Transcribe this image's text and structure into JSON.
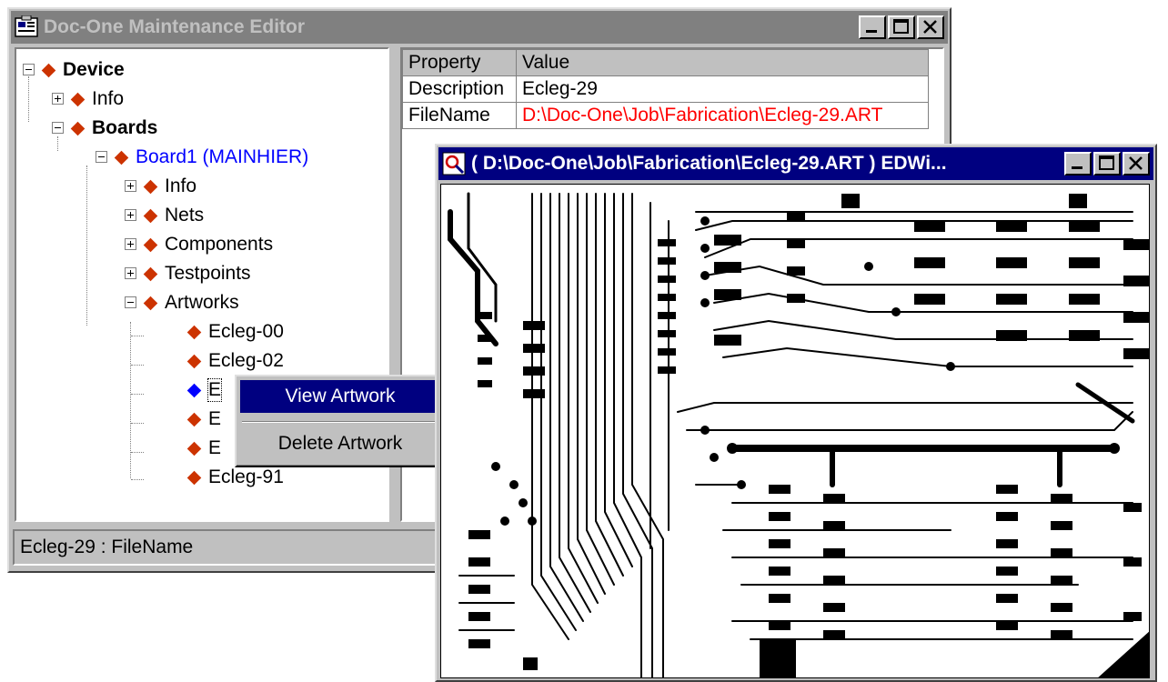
{
  "editor": {
    "title": "Doc-One Maintenance Editor",
    "tree": {
      "device": "Device",
      "info": "Info",
      "boards": "Boards",
      "board1": "Board1 (MAINHIER)",
      "board_info": "Info",
      "nets": "Nets",
      "components": "Components",
      "testpoints": "Testpoints",
      "artworks": "Artworks",
      "artwork_items": [
        "Ecleg-00",
        "Ecleg-02",
        "E",
        "E",
        "E",
        "Ecleg-91"
      ]
    },
    "properties": {
      "headers": [
        "Property",
        "Value"
      ],
      "rows": [
        {
          "property": "Description",
          "value": "Ecleg-29"
        },
        {
          "property": "FileName",
          "value": "D:\\Doc-One\\Job\\Fabrication\\Ecleg-29.ART"
        }
      ]
    },
    "status": "Ecleg-29 : FileName"
  },
  "context_menu": {
    "items": [
      "View Artwork",
      "Delete Artwork"
    ]
  },
  "viewer": {
    "title": "( D:\\Doc-One\\Job\\Fabrication\\Ecleg-29.ART ) EDWi..."
  },
  "colors": {
    "active_title": "#000080",
    "inactive_title": "#808080",
    "diamond": "#cc3300",
    "selected_diamond": "#0000ff",
    "board_text": "#0000ff",
    "filename_value": "#ff0000"
  },
  "icons": [
    "app-icon",
    "minimize-icon",
    "maximize-icon",
    "close-icon",
    "viewer-icon"
  ]
}
